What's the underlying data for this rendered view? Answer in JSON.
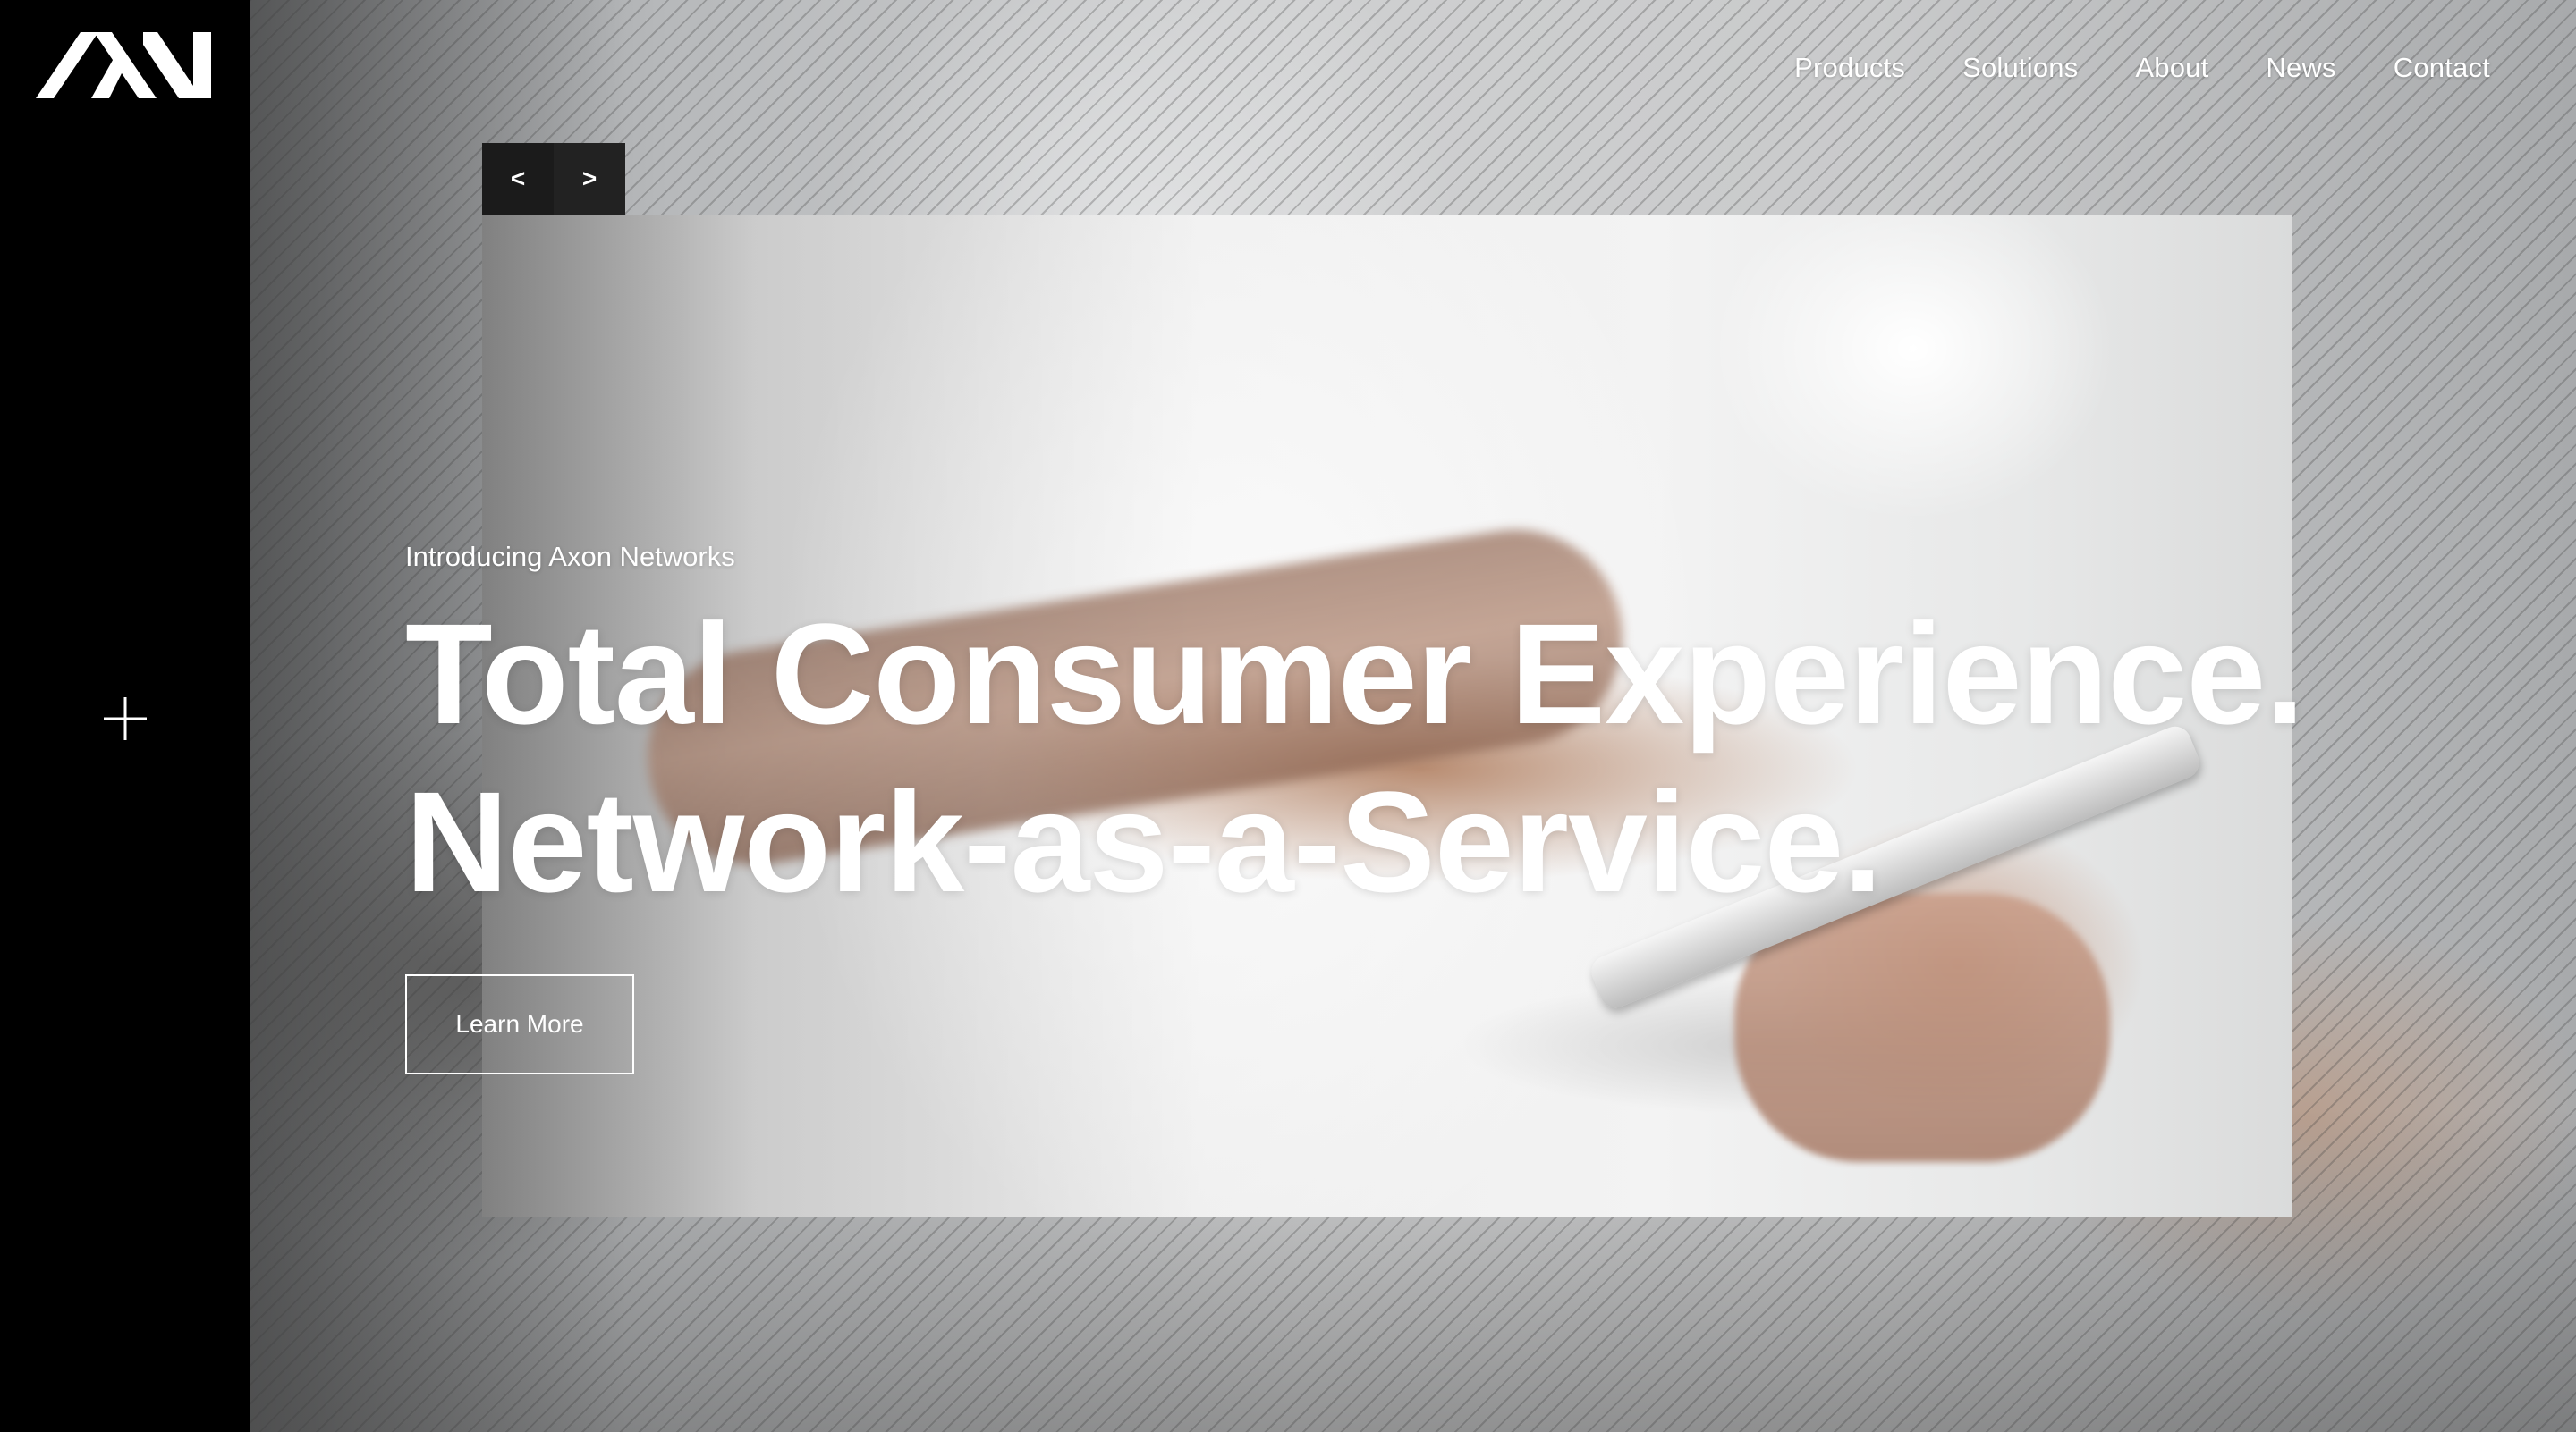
{
  "brand": {
    "logo_icon": "axon-networks-logo-icon",
    "colors": {
      "sidebar": "#000000",
      "text": "#ffffff",
      "arrow_bg": "#1b1b1b"
    }
  },
  "sidebar": {
    "menu_icon": "plus-icon"
  },
  "nav": {
    "items": [
      {
        "label": "Products"
      },
      {
        "label": "Solutions"
      },
      {
        "label": "About"
      },
      {
        "label": "News"
      },
      {
        "label": "Contact"
      }
    ]
  },
  "slider": {
    "prev_label": "<",
    "next_label": ">"
  },
  "hero": {
    "eyebrow": "Introducing Axon Networks",
    "headline_line1": "Total Consumer Experience.",
    "headline_line2": "Network-as-a-Service.",
    "cta_label": "Learn More"
  }
}
